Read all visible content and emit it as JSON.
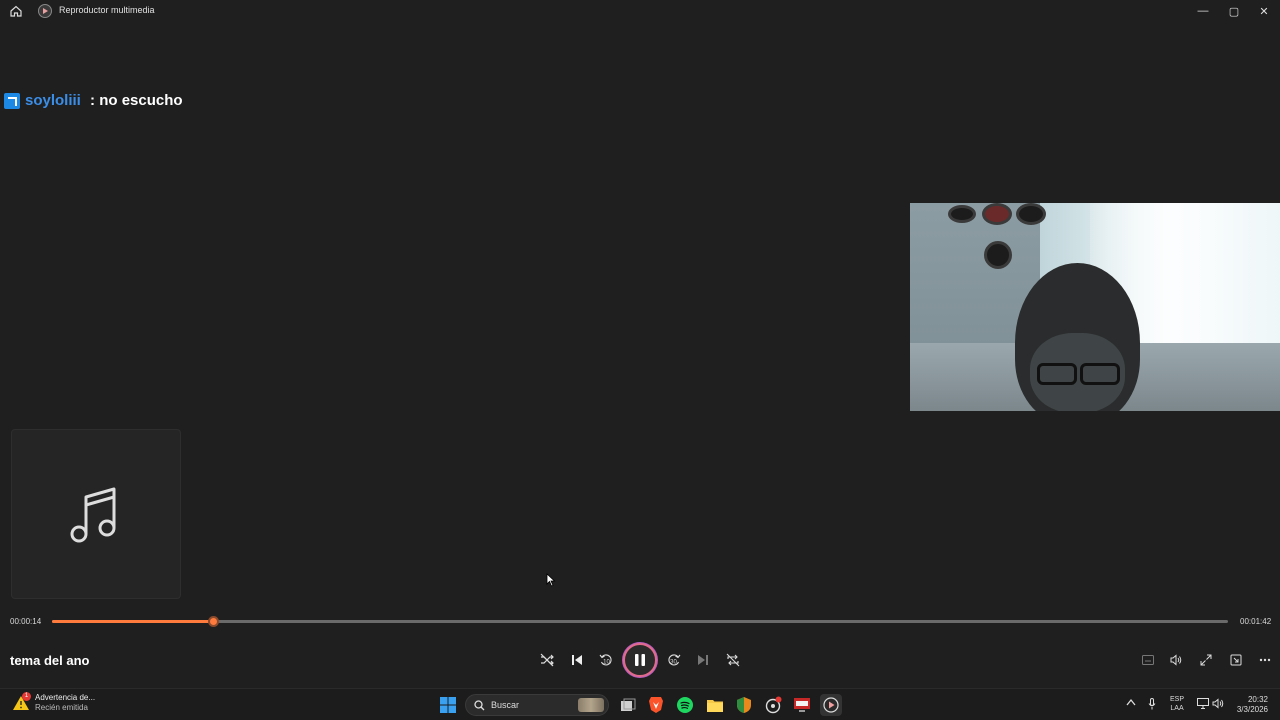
{
  "window": {
    "title": "Reproductor multimedia",
    "minimize_glyph": "—",
    "maximize_glyph": "▢",
    "close_glyph": "✕"
  },
  "chat": {
    "username": "soyloliii",
    "separator": " : ",
    "message": "no escucho"
  },
  "player": {
    "song_title": "tema del ano",
    "elapsed": "00:00:14",
    "duration": "00:01:42",
    "progress_fraction": 0.1373,
    "skip_back_seconds": "10",
    "skip_forward_seconds": "30",
    "accent_color": "#ff7a3d"
  },
  "taskbar": {
    "notification_title": "Advertencia de...",
    "notification_subtitle": "Recién emitida",
    "notification_badge": "1",
    "search_placeholder": "Buscar",
    "language_line1": "ESP",
    "language_line2": "LAA",
    "time": "20:32",
    "date": "3/3/2026"
  }
}
